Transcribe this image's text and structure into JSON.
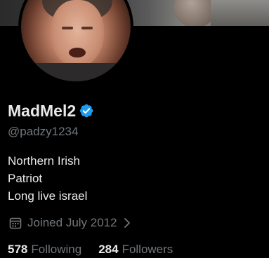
{
  "profile": {
    "display_name": "MadMel2",
    "handle": "@padzy1234",
    "verified": true,
    "bio_lines": [
      "Northern Irish",
      "Patriot",
      "Long live israel"
    ],
    "joined": "Joined July 2012",
    "following_count": "578",
    "following_label": "Following",
    "followers_count": "284",
    "followers_label": "Followers"
  },
  "icons": {
    "verified": "verified-badge-icon",
    "calendar": "calendar-icon",
    "chevron": "chevron-right-icon"
  },
  "colors": {
    "background": "#000000",
    "primary_text": "#e7e9ea",
    "secondary_text": "#71767b",
    "verified_blue": "#1d9bf0"
  }
}
